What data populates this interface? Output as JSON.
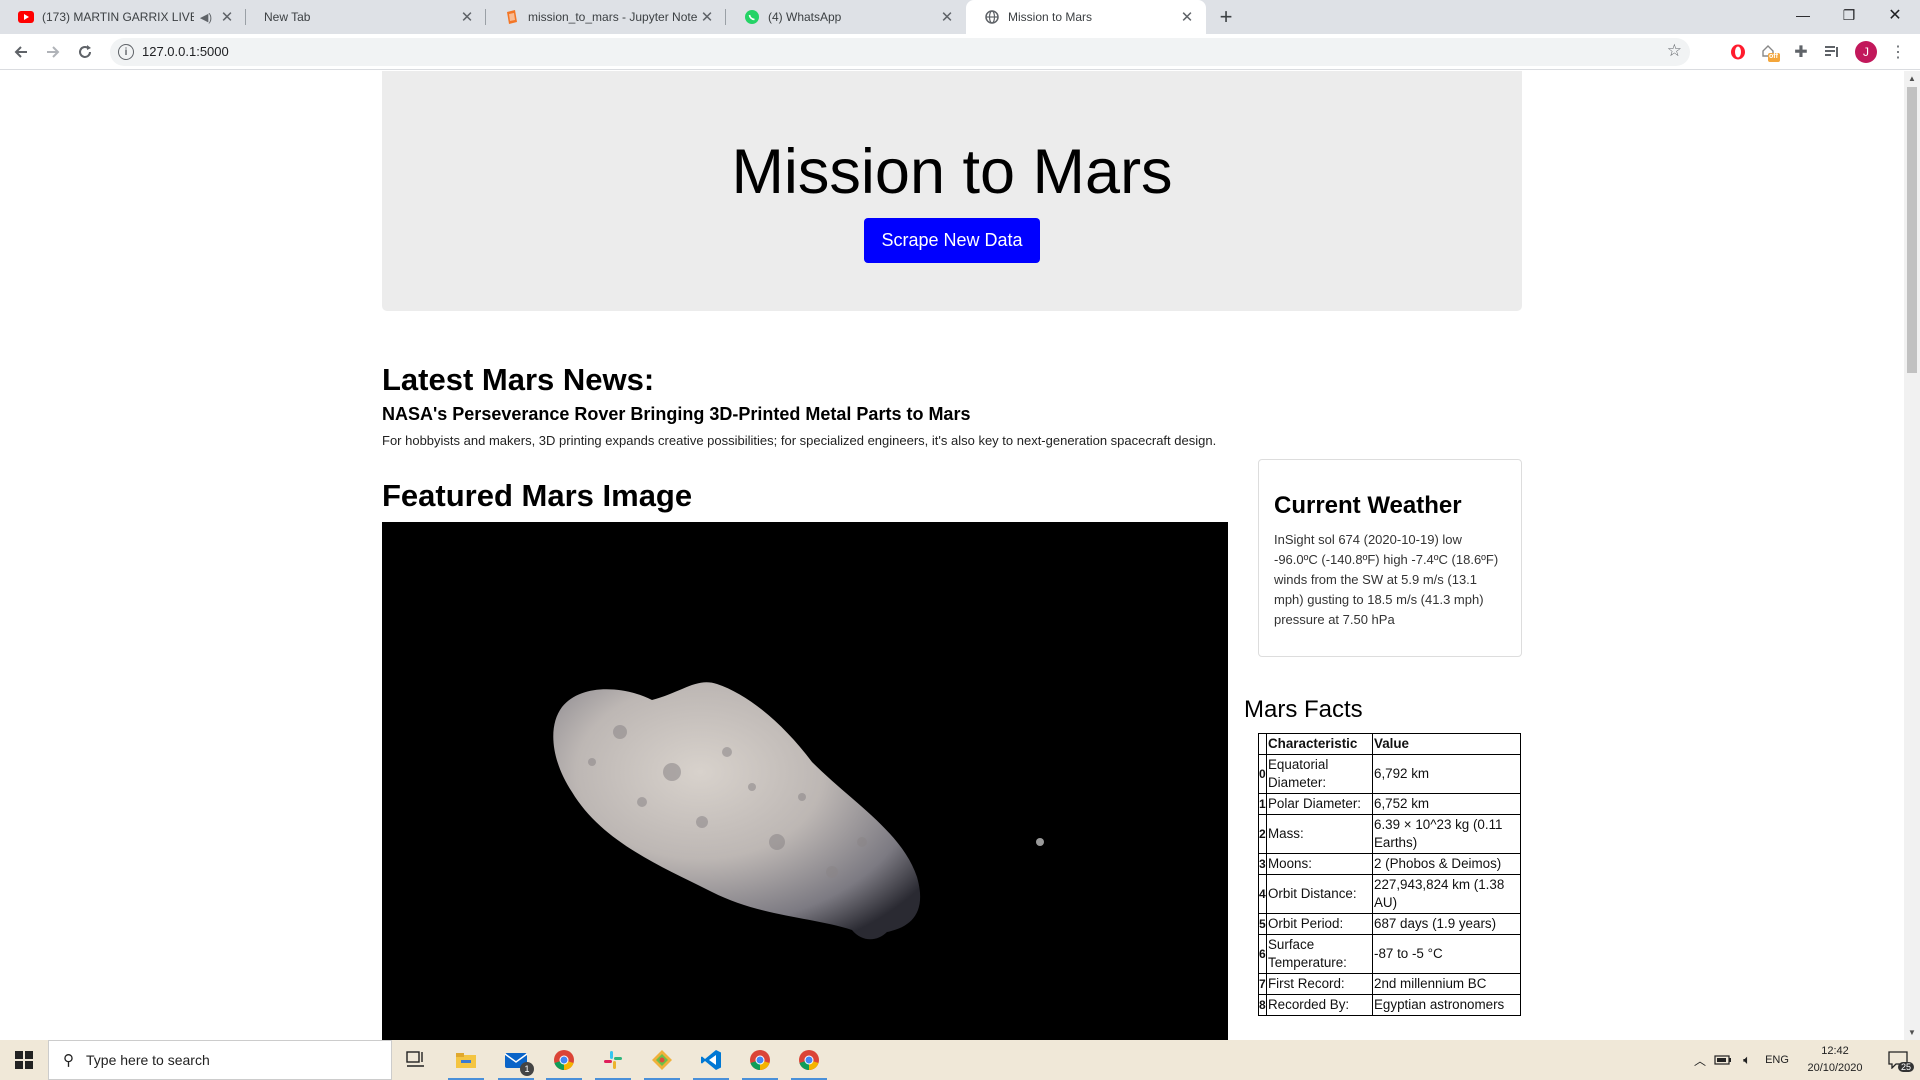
{
  "browser": {
    "tabs": [
      {
        "title": "(173) MARTIN GARRIX LIVE @",
        "icon": "youtube-icon"
      },
      {
        "title": "New Tab",
        "icon": ""
      },
      {
        "title": "mission_to_mars - Jupyter Noteb",
        "icon": "jupyter-icon"
      },
      {
        "title": "(4) WhatsApp",
        "icon": "whatsapp-icon"
      },
      {
        "title": "Mission to Mars",
        "icon": "globe-icon"
      }
    ],
    "url": "127.0.0.1:5000",
    "profile_initial": "J",
    "extension_badge": "off"
  },
  "page": {
    "title": "Mission to Mars",
    "scrape_button": "Scrape New Data",
    "news_heading": "Latest Mars News:",
    "news_title": "NASA's Perseverance Rover Bringing 3D-Printed Metal Parts to Mars",
    "news_paragraph": "For hobbyists and makers, 3D printing expands creative possibilities; for specialized engineers, it's also key to next-generation spacecraft design.",
    "featured_heading": "Featured Mars Image",
    "weather_heading": "Current Weather",
    "weather_text": "InSight sol 674 (2020-10-19) low -96.0ºC (-140.8ºF) high -7.4ºC (18.6ºF) winds from the SW at 5.9 m/s (13.1 mph) gusting to 18.5 m/s (41.3 mph) pressure at 7.50 hPa",
    "facts_heading": "Mars Facts",
    "facts_table": {
      "headers": [
        "Characteristic",
        "Value"
      ],
      "rows": [
        {
          "index": "0",
          "characteristic": "Equatorial Diameter:",
          "value": "6,792 km"
        },
        {
          "index": "1",
          "characteristic": "Polar Diameter:",
          "value": "6,752 km"
        },
        {
          "index": "2",
          "characteristic": "Mass:",
          "value": "6.39 × 10^23 kg (0.11 Earths)"
        },
        {
          "index": "3",
          "characteristic": "Moons:",
          "value": "2 (Phobos & Deimos)"
        },
        {
          "index": "4",
          "characteristic": "Orbit Distance:",
          "value": "227,943,824 km (1.38 AU)"
        },
        {
          "index": "5",
          "characteristic": "Orbit Period:",
          "value": "687 days (1.9 years)"
        },
        {
          "index": "6",
          "characteristic": "Surface Temperature:",
          "value": "-87 to -5 °C"
        },
        {
          "index": "7",
          "characteristic": "First Record:",
          "value": "2nd millennium BC"
        },
        {
          "index": "8",
          "characteristic": "Recorded By:",
          "value": "Egyptian astronomers"
        }
      ]
    }
  },
  "taskbar": {
    "search_placeholder": "Type here to search",
    "mail_badge": "1",
    "language": "ENG",
    "time": "12:42",
    "date": "20/10/2020",
    "notifications": "25"
  },
  "colors": {
    "button_bg": "#0000ff",
    "jumbotron_bg": "#ececec",
    "tabstrip_bg": "#dee1e6"
  }
}
